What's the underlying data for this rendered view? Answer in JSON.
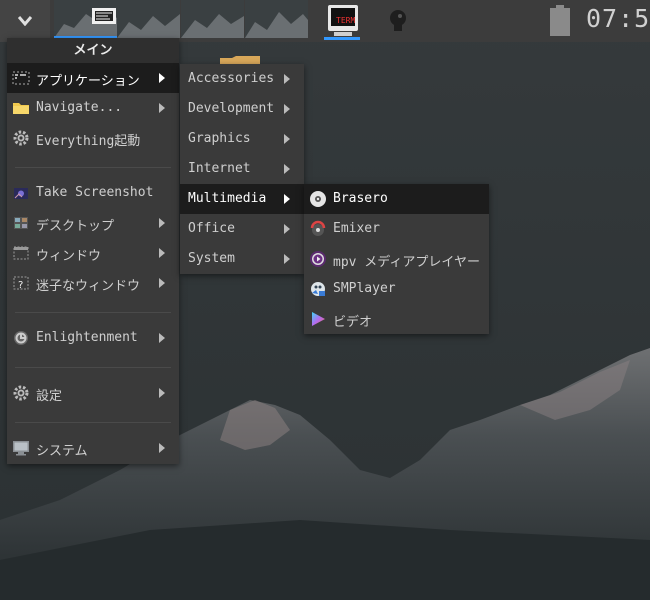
{
  "shelf": {
    "clock": "07:5",
    "accent_color": "#3399ff",
    "start_icon": "chevron-down-icon",
    "term_label": "TERM"
  },
  "main_menu": {
    "title": "メイン",
    "items": [
      {
        "label": "アプリケーション",
        "icon": "applications-icon",
        "arrow": true,
        "active": true
      },
      {
        "label": "Navigate...",
        "icon": "folder-icon",
        "arrow": true
      },
      {
        "label": "Everything起動",
        "icon": "gear-icon",
        "arrow": false
      },
      {
        "label": "Take Screenshot",
        "icon": "screenshot-icon",
        "arrow": false
      },
      {
        "label": "デスクトップ",
        "icon": "desktop-icon",
        "arrow": true
      },
      {
        "label": "ウィンドウ",
        "icon": "window-icon",
        "arrow": true
      },
      {
        "label": "迷子なウィンドウ",
        "icon": "lost-window-icon",
        "arrow": true
      },
      {
        "label": "Enlightenment",
        "icon": "enlightenment-icon",
        "arrow": true
      },
      {
        "label": "設定",
        "icon": "gear-icon",
        "arrow": true
      },
      {
        "label": "システム",
        "icon": "computer-icon",
        "arrow": true
      }
    ]
  },
  "apps_menu": {
    "items": [
      {
        "label": "Accessories"
      },
      {
        "label": "Development"
      },
      {
        "label": "Graphics"
      },
      {
        "label": "Internet"
      },
      {
        "label": "Multimedia",
        "active": true
      },
      {
        "label": "Office"
      },
      {
        "label": "System"
      }
    ]
  },
  "multimedia_menu": {
    "items": [
      {
        "label": "Brasero",
        "icon": "disc-icon",
        "active": true
      },
      {
        "label": "Emixer",
        "icon": "mixer-icon"
      },
      {
        "label": "mpv メディアプレイヤー",
        "icon": "mpv-icon"
      },
      {
        "label": "SMPlayer",
        "icon": "smplayer-icon"
      },
      {
        "label": "ビデオ",
        "icon": "video-play-icon"
      }
    ]
  }
}
